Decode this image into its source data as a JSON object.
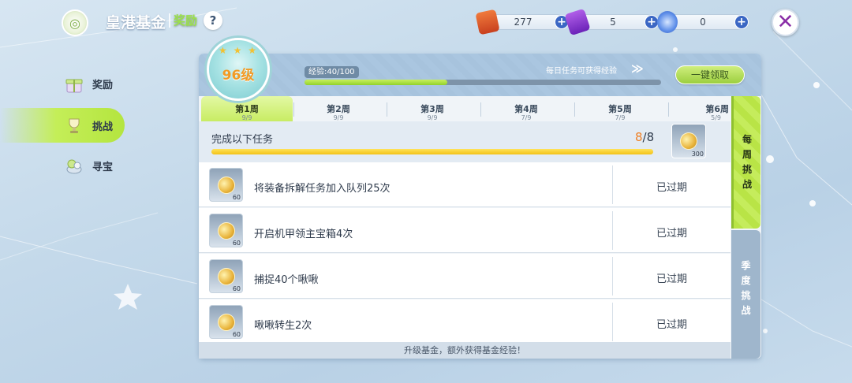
{
  "header": {
    "title": "皇港基金",
    "subtitle": "奖励",
    "help_glyph": "?"
  },
  "resources": [
    {
      "name": "ticket",
      "icon": "ticket-icon",
      "value": "277",
      "color": "#e0542a"
    },
    {
      "name": "card",
      "icon": "purple-card-icon",
      "value": "5",
      "color": "#8a3fd1"
    },
    {
      "name": "crystal",
      "icon": "crystal-icon",
      "value": "0",
      "color": "#5c8de8"
    }
  ],
  "close_glyph": "✕",
  "sidebar": {
    "items": [
      {
        "label": "奖励",
        "icon": "gift-icon",
        "active": false
      },
      {
        "label": "挑战",
        "icon": "trophy-icon",
        "active": true
      },
      {
        "label": "寻宝",
        "icon": "treasure-icon",
        "active": false
      }
    ]
  },
  "level": {
    "value": "96级",
    "stars": "★ ★ ★"
  },
  "experience": {
    "label": "经验:40/100",
    "current": 40,
    "max": 100,
    "daily_note": "每日任务可获得经验",
    "arrow_glyph": "≫",
    "claim_all_label": "一键领取"
  },
  "week_tabs": [
    {
      "label": "第1周",
      "progress": "9/9",
      "active": true
    },
    {
      "label": "第2周",
      "progress": "9/9",
      "active": false
    },
    {
      "label": "第3周",
      "progress": "9/9",
      "active": false
    },
    {
      "label": "第4周",
      "progress": "7/9",
      "active": false
    },
    {
      "label": "第5周",
      "progress": "7/9",
      "active": false
    },
    {
      "label": "第6周",
      "progress": "5/9",
      "active": false
    }
  ],
  "summary": {
    "title": "完成以下任务",
    "current": "8",
    "total": "/8",
    "progress_fraction": 1.0,
    "reward_amount": "300"
  },
  "tasks": [
    {
      "description": "将装备拆解任务加入队列25次",
      "reward": "60",
      "status": "已过期"
    },
    {
      "description": "开启机甲领主宝箱4次",
      "reward": "60",
      "status": "已过期"
    },
    {
      "description": "捕捉40个啾啾",
      "reward": "60",
      "status": "已过期"
    },
    {
      "description": "啾啾转生2次",
      "reward": "60",
      "status": "已过期"
    }
  ],
  "footer_note": "升级基金，额外获得基金经验！",
  "side_tabs": [
    {
      "label": "每周挑战",
      "chars": [
        "每",
        "周",
        "挑",
        "战"
      ],
      "active": true
    },
    {
      "label": "季度挑战",
      "chars": [
        "季",
        "度",
        "挑",
        "战"
      ],
      "active": false
    }
  ]
}
